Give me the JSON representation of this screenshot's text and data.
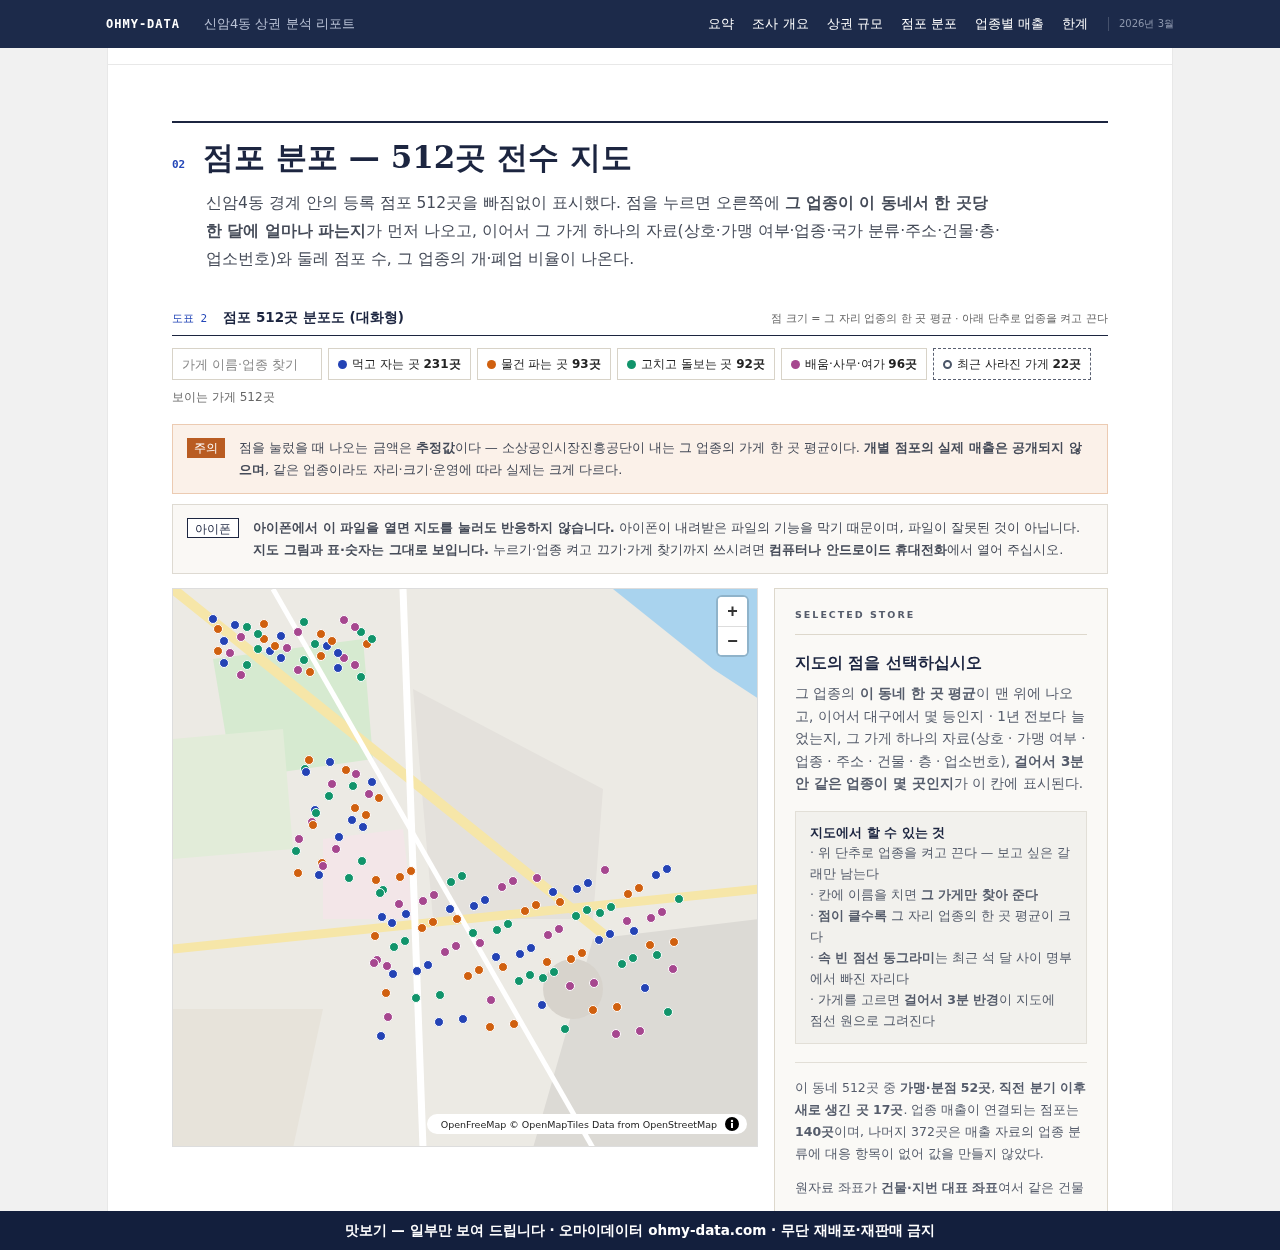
{
  "brand": "OHMY-DATA",
  "report_title": "신암4동 상권 분석 리포트",
  "nav": [
    {
      "label": "요약"
    },
    {
      "label": "조사 개요"
    },
    {
      "label": "상권 규모"
    },
    {
      "label": "점포 분포"
    },
    {
      "label": "업종별 매출"
    },
    {
      "label": "한계"
    }
  ],
  "date": "2026년 3월",
  "section": {
    "number": "02",
    "title": "점포 분포 — 512곳 전수 지도",
    "intro": "신암4동 경계 안의 등록 점포 512곳을 빠짐없이 표시했다. 점을 누르면 오른쪽에 **그 업종이 이 동네서 한 곳당 한 달에 얼마나 파는지**가 먼저 나오고, 이어서 그 가게 하나의 자료(상호·가맹 여부·업종·국가 분류·주소·건물·층·업소번호)와 둘레 점포 수, 그 업종의 개·폐업 비율이 나온다."
  },
  "figure": {
    "label": "도표 2",
    "title": "점포 512곳 분포도 (대화형)",
    "note": "점 크기 = 그 자리 업종의 한 곳 평균 · 아래 단추로 업종을 켜고 끈다"
  },
  "search": {
    "placeholder": "가게 이름·업종 찾기"
  },
  "filters": [
    {
      "kind": "solid",
      "label": "먹고 자는 곳",
      "count": "231곳",
      "color": "#2443b5"
    },
    {
      "kind": "solid",
      "label": "물건 파는 곳",
      "count": "93곳",
      "color": "#d0600f"
    },
    {
      "kind": "solid",
      "label": "고치고 돌보는 곳",
      "count": "92곳",
      "color": "#11946b"
    },
    {
      "kind": "solid",
      "label": "배움·사무·여가",
      "count": "96곳",
      "color": "#a6478f"
    },
    {
      "kind": "hollow",
      "label": "최근 사라진 가게",
      "count": "22곳",
      "color": "#4a5568"
    }
  ],
  "visible_count": "보이는 가게 512곳",
  "notices": [
    {
      "kind": "caution",
      "tag": "주의",
      "text": "점을 눌렀을 때 나오는 금액은 **추정값**이다 — 소상공인시장진흥공단이 내는 그 업종의 가게 한 곳 평균이다. **개별 점포의 실제 매출은 공개되지 않으며**, 같은 업종이라도 자리·크기·운영에 따라 실제는 크게 다르다."
    },
    {
      "kind": "device",
      "tag": "아이폰",
      "text": "**아이폰에서 이 파일을 열면 지도를 눌러도 반응하지 않습니다.** 아이폰이 내려받은 파일의 기능을 막기 때문이며, 파일이 잘못된 것이 아닙니다. **지도 그림과 표·숫자는 그대로 보입니다.** 누르기·업종 켜고 끄기·가게 찾기까지 쓰시려면 **컴퓨터나 안드로이드 휴대전화**에서 열어 주십시오."
    }
  ],
  "map": {
    "zoom_in": "+",
    "zoom_out": "−",
    "attribution": "OpenFreeMap © OpenMapTiles Data from OpenStreetMap"
  },
  "panel": {
    "eyebrow": "SELECTED STORE",
    "title": "지도의 점을 선택하십시오",
    "text": "그 업종의 **이 동네 한 곳 평균**이 맨 위에 나오고, 이어서 대구에서 몇 등인지 · 1년 전보다 늘었는지, 그 가게 하나의 자료(상호 · 가맹 여부 · 업종 · 주소 · 건물 · 층 · 업소번호), **걸어서 3분 안 같은 업종이 몇 곳인지**가 이 칸에 표시된다.",
    "tips": {
      "title": "지도에서 할 수 있는 것",
      "items": [
        "· 위 단추로 업종을 켜고 끈다 — 보고 싶은 갈래만 남는다",
        "· 칸에 이름을 치면 **그 가게만 찾아 준다**",
        "· **점이 클수록** 그 자리 업종의 한 곳 평균이 크다",
        "· **속 빈 점선 동그라미**는 최근 석 달 사이 명부에서 빠진 자리다",
        "· 가게를 고르면 **걸어서 3분 반경**이 지도에 점선 원으로 그려진다"
      ]
    },
    "paragraphs": [
      "이 동네 512곳 중 **가맹·분점 52곳**, **직전 분기 이후 새로 생긴 곳 17곳**. 업종 매출이 연결되는 점포는 **140곳**이며, 나머지 372곳은 매출 자료의 업종 분류에 대응 항목이 없어 값을 만들지 않았다.",
      "원자료 좌표가 **건물·지번 대표 좌표**여서 같은 건물"
    ]
  },
  "footer": "맛보기 — 일부만 보여 드립니다 · 오마이데이터 ohmy-data.com · 무단 재배포·재판매 금지"
}
